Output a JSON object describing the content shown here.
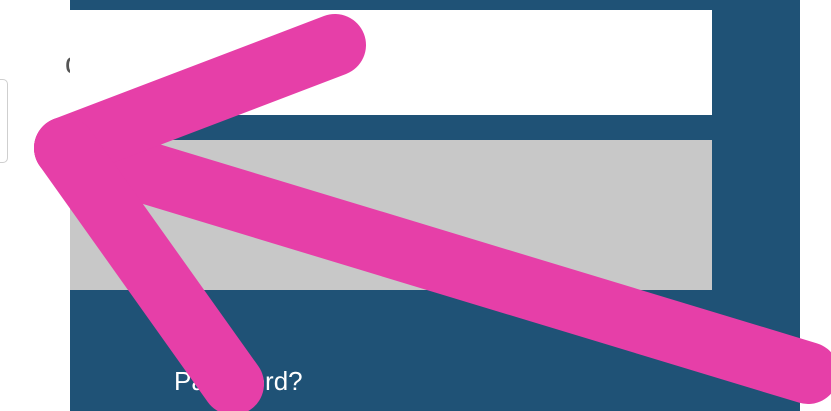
{
  "background": {
    "partial_label": "d"
  },
  "login": {
    "username_value": "",
    "password_value": "",
    "forgot_password_label": "Password?"
  },
  "annotation": {
    "arrow_color": "#e63fa8",
    "arrow_icon": "arrow-pointing-up-left"
  },
  "colors": {
    "panel_bg": "#1f5276",
    "field_bg": "#ffffff",
    "field_disabled_bg": "#c8c8c8",
    "link_text": "#ffffff"
  }
}
